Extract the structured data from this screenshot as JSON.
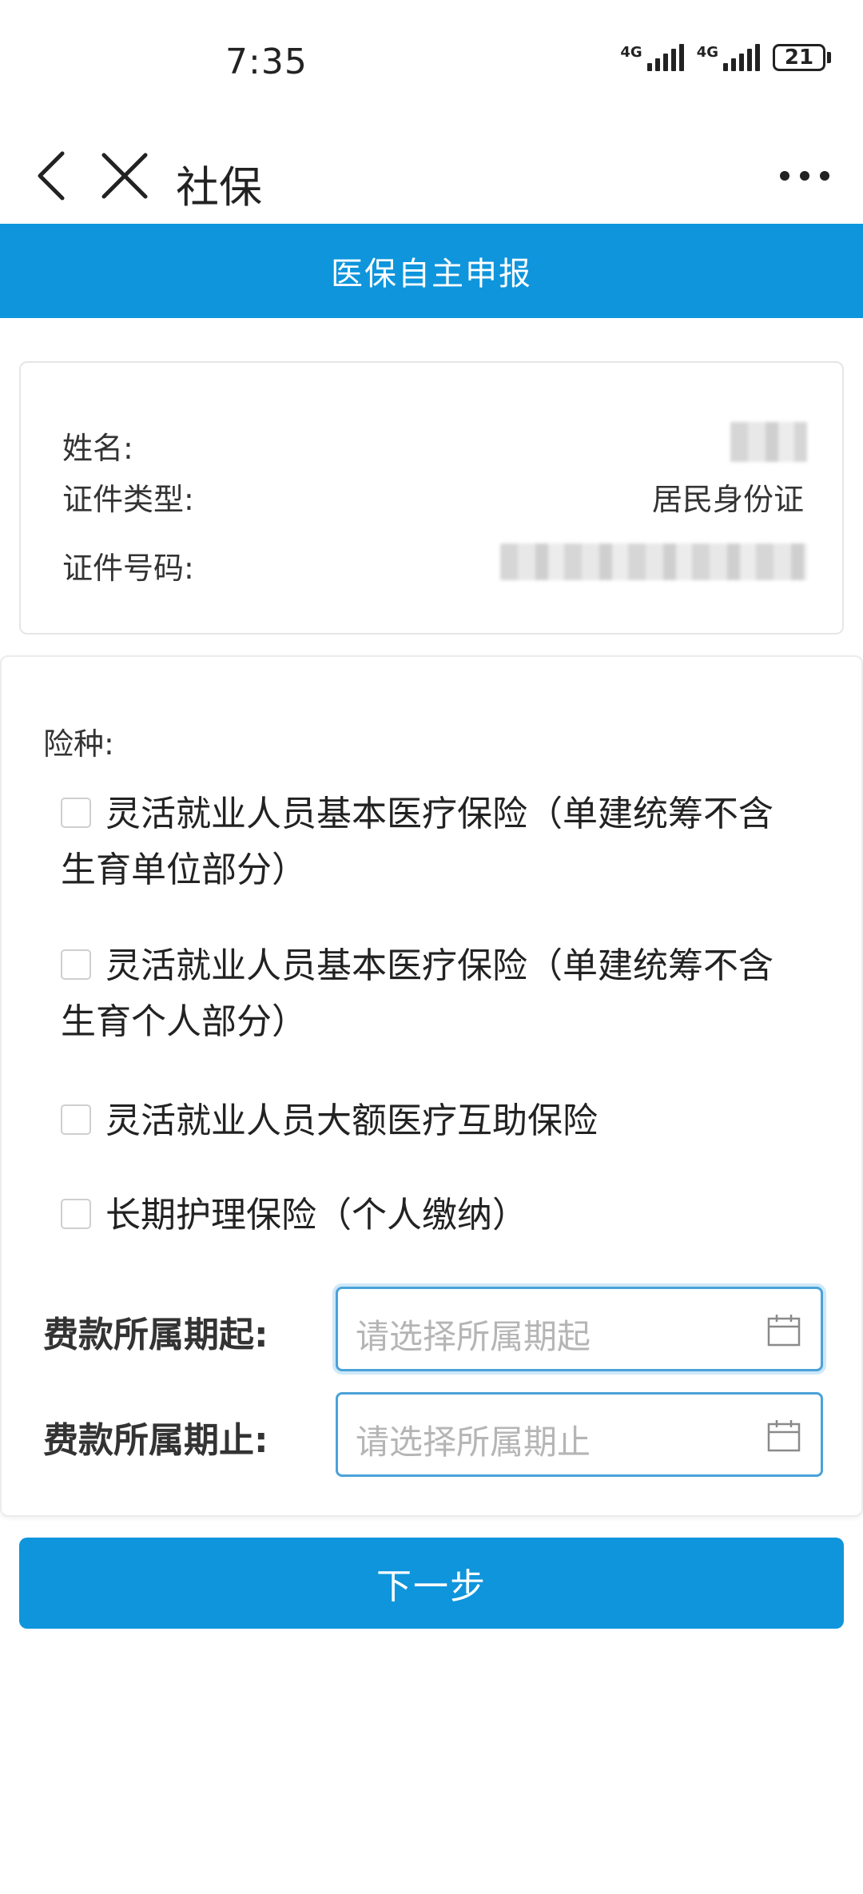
{
  "status_bar": {
    "time": "7:35",
    "network_1": "4G",
    "network_2": "4G",
    "battery": "21"
  },
  "nav": {
    "title": "社保"
  },
  "header": {
    "title": "医保自主申报"
  },
  "info": {
    "name_label": "姓名:",
    "id_type_label": "证件类型:",
    "id_type_value": "居民身份证",
    "id_number_label": "证件号码:"
  },
  "form": {
    "insurance_label": "险种:",
    "options": [
      {
        "label": "灵活就业人员基本医疗保险（单建统筹不含生育单位部分）",
        "checked": false
      },
      {
        "label": "灵活就业人员基本医疗保险（单建统筹不含生育个人部分）",
        "checked": false
      },
      {
        "label": "灵活就业人员大额医疗互助保险",
        "checked": false
      },
      {
        "label": "长期护理保险（个人缴纳）",
        "checked": false
      }
    ],
    "period_start_label": "费款所属期起:",
    "period_start_placeholder": "请选择所属期起",
    "period_end_label": "费款所属期止:",
    "period_end_placeholder": "请选择所属期止"
  },
  "next_button": {
    "label": "下一步"
  },
  "colors": {
    "primary": "#0e95dc",
    "input_border": "#4aa2d9",
    "placeholder": "#b5b5b5"
  }
}
